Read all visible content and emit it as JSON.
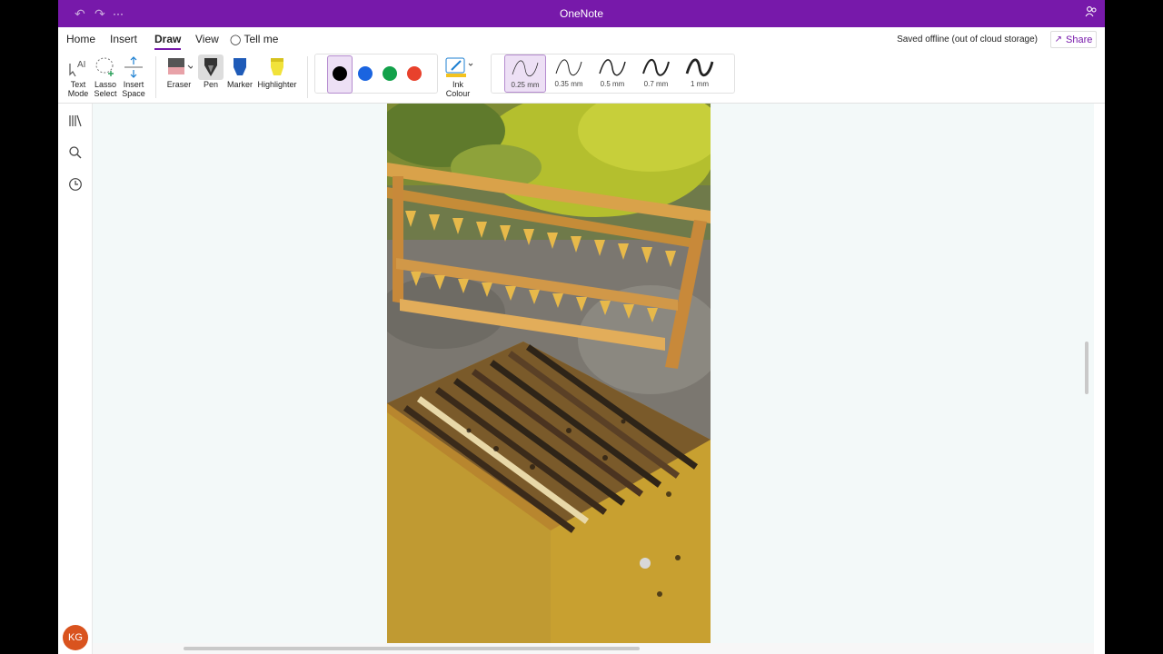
{
  "app": {
    "title": "OneNote",
    "more_label": "···"
  },
  "menu": {
    "tabs": [
      "Home",
      "Insert",
      "Draw",
      "View"
    ],
    "active_tab": "Draw",
    "tell_me": "Tell me",
    "saved_status": "Saved offline (out of cloud storage)",
    "share_label": "Share"
  },
  "ribbon": {
    "text_mode": [
      "Text",
      "Mode"
    ],
    "lasso_select": [
      "Lasso",
      "Select"
    ],
    "insert_space": [
      "Insert",
      "Space"
    ],
    "eraser": "Eraser",
    "pen": "Pen",
    "marker": "Marker",
    "highlighter": "Highlighter",
    "ink_colour": [
      "Ink",
      "Colour"
    ],
    "colors": [
      "#000000",
      "#1a64e0",
      "#12a14a",
      "#e8412c"
    ],
    "selected_color": "#000000",
    "strokes": [
      "0.25 mm",
      "0.35 mm",
      "0.5 mm",
      "0.7 mm",
      "1 mm"
    ],
    "selected_stroke": "0.25 mm"
  },
  "user": {
    "initials": "KG"
  },
  "colors": {
    "accent": "#7719aa",
    "canvas": "#f3f9f9",
    "avatar": "#d9531e"
  }
}
